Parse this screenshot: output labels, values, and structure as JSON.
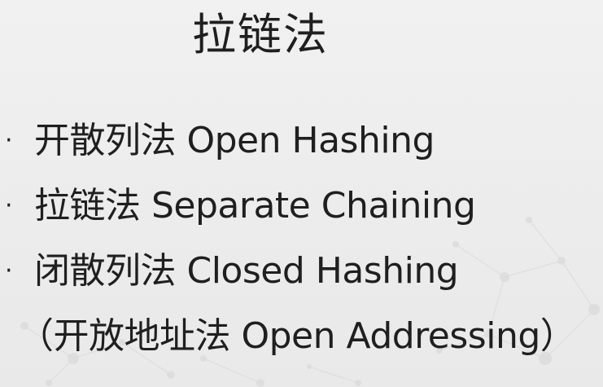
{
  "slide": {
    "title": "拉链法",
    "bullet_marker": "·",
    "bullets": [
      "开散列法 Open Hashing",
      "拉链法 Separate Chaining",
      "闭散列法 Closed Hashing"
    ],
    "continuation": "（开放地址法 Open Addressing）"
  }
}
